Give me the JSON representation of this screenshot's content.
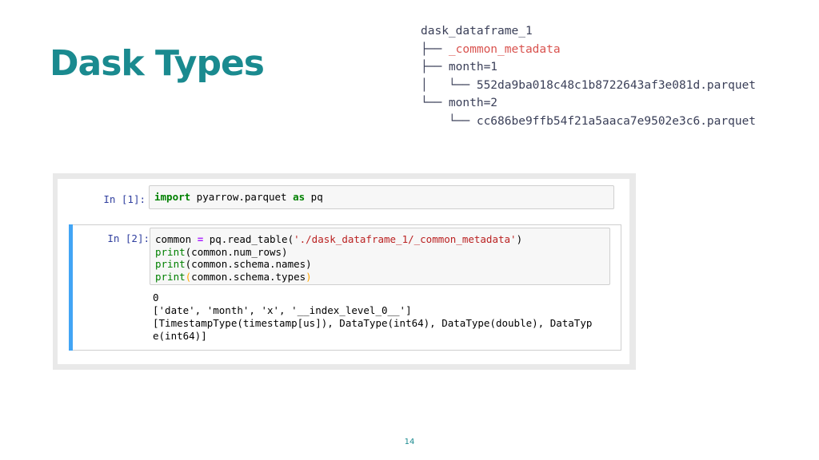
{
  "slide": {
    "title": "Dask Types",
    "page_number": "14"
  },
  "tree": {
    "lines": [
      {
        "conn": "",
        "name": "dask_dataframe_1",
        "highlight": false
      },
      {
        "conn": "├── ",
        "name": "_common_metadata",
        "highlight": true
      },
      {
        "conn": "├── ",
        "name": "month=1",
        "highlight": false
      },
      {
        "conn": "│   └── ",
        "name": "552da9ba018c48c1b8722643af3e081d.parquet",
        "highlight": false
      },
      {
        "conn": "└── ",
        "name": "month=2",
        "highlight": false
      },
      {
        "conn": "    └── ",
        "name": "cc686be9ffb54f21a5aaca7e9502e3c6.parquet",
        "highlight": false
      }
    ]
  },
  "notebook": {
    "cell1": {
      "prompt": "In [1]:",
      "code": {
        "kw_import": "import",
        "module": " pyarrow.parquet ",
        "kw_as": "as",
        "alias": " pq"
      }
    },
    "cell2": {
      "prompt": "In [2]:",
      "code": {
        "line1_a": "common ",
        "line1_op": "=",
        "line1_b": " pq.read_table(",
        "line1_str": "'./dask_dataframe_1/_common_metadata'",
        "line1_c": ")",
        "line2_fn": "print",
        "line2_rest": "(common.num_rows)",
        "line3_fn": "print",
        "line3_rest": "(common.schema.names)",
        "line4_fn": "print",
        "line4_open": "(",
        "line4_mid": "common.schema.types",
        "line4_close": ")"
      },
      "output": [
        "0",
        "['date', 'month', 'x', '__index_level_0__']",
        "[TimestampType(timestamp[us]), DataType(int64), DataType(double), DataTyp",
        "e(int64)]"
      ]
    }
  },
  "colors": {
    "title": "#1a8a8f",
    "tree_text": "#3a3f58",
    "tree_highlight": "#d9534f",
    "cell_selected_border": "#42a5f5",
    "prompt": "#303f9f"
  }
}
